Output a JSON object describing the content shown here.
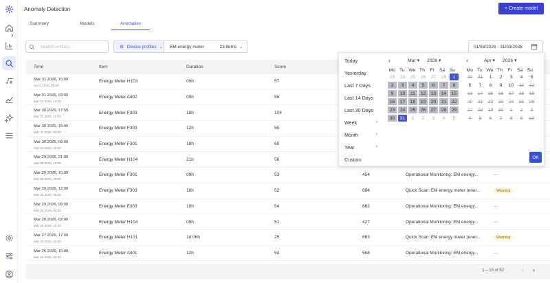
{
  "header": {
    "title": "Anomaly Detection",
    "create_button": "+ Create model"
  },
  "tabs": [
    {
      "label": "Summary"
    },
    {
      "label": "Models"
    },
    {
      "label": "Anomalies"
    }
  ],
  "filters": {
    "search_placeholder": "Search entities ...",
    "profile_button": "Device profiles",
    "profile_value": "EM energy meter",
    "profile_count": "23 items",
    "date_range": "01/03/2026 - 31/03/2026"
  },
  "table": {
    "columns": {
      "time": "Time",
      "item": "Item",
      "duration": "Duration",
      "score": "Score"
    },
    "rows": [
      {
        "time": "Mar 31 2026, 15:00",
        "sub": "Apr 1 2026, 00:00",
        "item": "Energy Meter H103",
        "duration": "09h",
        "score": "57",
        "count": "",
        "source": "",
        "extra": "",
        "badge": ""
      },
      {
        "time": "Mar 31 2026, 03:00",
        "sub": "Mar 31 2026, 12:00",
        "item": "Energy Meter A402",
        "duration": "09h",
        "score": "56",
        "count": "",
        "source": "",
        "extra": "",
        "badge": ""
      },
      {
        "time": "Mar 30 2026, 17:59",
        "sub": "Mar 31 2026, 11:59",
        "item": "Energy Meter F303",
        "duration": "18h",
        "score": "104",
        "count": "",
        "source": "",
        "extra": "",
        "badge": ""
      },
      {
        "time": "Mar 30 2026, 15:00",
        "sub": "Mar 31 2026, 03:00",
        "item": "Energy Meter F303",
        "duration": "12h",
        "score": "55",
        "count": "",
        "source": "",
        "extra": "",
        "badge": ""
      },
      {
        "time": "Mar 30 2026, 09:00",
        "sub": "Mar 31 2026, 00:00",
        "item": "Energy Meter F301",
        "duration": "18h",
        "score": "60",
        "count": "",
        "source": "",
        "extra": "",
        "badge": ""
      },
      {
        "time": "Mar 29 2026, 21:00",
        "sub": "Mar 30 2026, 18:00",
        "item": "Energy Meter H104",
        "duration": "21h",
        "score": "56",
        "count": "",
        "source": "",
        "extra": "",
        "badge": ""
      },
      {
        "time": "Mar 29 2026, 15:00",
        "sub": "Mar 30 2026, 00:00",
        "item": "Energy Meter F301",
        "duration": "09h",
        "score": "53",
        "count": "454",
        "source": "Operational Monitoring: EM energy...",
        "extra": "—",
        "badge": ""
      },
      {
        "time": "Mar 29 2026, 12:00",
        "sub": "Mar 30 2026, 06:00",
        "item": "Energy Meter F303",
        "duration": "18h",
        "score": "52",
        "count": "684",
        "source": "Quick Scan: EM energy meter (ener...",
        "extra": "",
        "badge": "Warning"
      },
      {
        "time": "Mar 29 2026, 09:00",
        "sub": "Mar 30 2026, 03:00",
        "item": "Energy Meter F303",
        "duration": "18h",
        "score": "54",
        "count": "862",
        "source": "Operational Monitoring: EM energy...",
        "extra": "—",
        "badge": ""
      },
      {
        "time": "Mar 28 2026, 02:00",
        "sub": "Mar 28 2026, 11:00",
        "item": "Energy Meter H104",
        "duration": "09h",
        "score": "51",
        "count": "427",
        "source": "Operational Monitoring: EM energy...",
        "extra": "—",
        "badge": ""
      },
      {
        "time": "Mar 27 2026, 17:00",
        "sub": "Mar 29 2026, 00:00",
        "item": "Energy Meter H101",
        "duration": "1d 06h",
        "score": "25",
        "count": "663",
        "source": "Quick Scan: EM energy meter (ener...",
        "extra": "",
        "badge": "Warning"
      },
      {
        "time": "Mar 26 2026, 15:00",
        "sub": "Mar 26 2026, 03:00",
        "item": "Energy Meter A401",
        "duration": "12h",
        "score": "53",
        "count": "558",
        "source": "Operational Monitoring: EM energy...",
        "extra": "—",
        "badge": ""
      }
    ],
    "pagination": "1 – 15 of 52"
  },
  "datepicker": {
    "presets": [
      {
        "label": "Today",
        "arrow": ""
      },
      {
        "label": "Yesterday",
        "arrow": ""
      },
      {
        "label": "Last 7 Days",
        "arrow": ""
      },
      {
        "label": "Last 14 Days",
        "arrow": ""
      },
      {
        "label": "Last 30 Days",
        "arrow": ""
      },
      {
        "label": "Week",
        "arrow": "›"
      },
      {
        "label": "Month",
        "arrow": "›"
      },
      {
        "label": "Year",
        "arrow": "›"
      },
      {
        "label": "Custom",
        "arrow": ""
      }
    ],
    "weekdays": [
      "Mo",
      "Tu",
      "We",
      "Th",
      "Fr",
      "Sa",
      "Su"
    ],
    "left": {
      "month": "Mar",
      "year": "2026",
      "days": [
        {
          "d": "23",
          "s": "muted"
        },
        {
          "d": "24",
          "s": "muted"
        },
        {
          "d": "25",
          "s": "muted"
        },
        {
          "d": "26",
          "s": "muted"
        },
        {
          "d": "27",
          "s": "muted"
        },
        {
          "d": "28",
          "s": "muted"
        },
        {
          "d": "1",
          "s": "sel"
        },
        {
          "d": "2",
          "s": "range"
        },
        {
          "d": "3",
          "s": "range"
        },
        {
          "d": "4",
          "s": "range"
        },
        {
          "d": "5",
          "s": "range"
        },
        {
          "d": "6",
          "s": "range"
        },
        {
          "d": "7",
          "s": "range"
        },
        {
          "d": "8",
          "s": "range"
        },
        {
          "d": "9",
          "s": "range"
        },
        {
          "d": "10",
          "s": "range"
        },
        {
          "d": "11",
          "s": "range"
        },
        {
          "d": "12",
          "s": "range"
        },
        {
          "d": "13",
          "s": "range"
        },
        {
          "d": "14",
          "s": "range"
        },
        {
          "d": "15",
          "s": "range"
        },
        {
          "d": "16",
          "s": "range"
        },
        {
          "d": "17",
          "s": "range"
        },
        {
          "d": "18",
          "s": "range"
        },
        {
          "d": "19",
          "s": "range"
        },
        {
          "d": "20",
          "s": "range"
        },
        {
          "d": "21",
          "s": "range"
        },
        {
          "d": "22",
          "s": "range"
        },
        {
          "d": "23",
          "s": "range"
        },
        {
          "d": "24",
          "s": "range"
        },
        {
          "d": "25",
          "s": "range"
        },
        {
          "d": "26",
          "s": "range"
        },
        {
          "d": "27",
          "s": "range"
        },
        {
          "d": "28",
          "s": "range"
        },
        {
          "d": "29",
          "s": "range"
        },
        {
          "d": "30",
          "s": "range"
        },
        {
          "d": "31",
          "s": "sel"
        },
        {
          "d": "1",
          "s": "muted"
        },
        {
          "d": "2",
          "s": "muted"
        },
        {
          "d": "3",
          "s": "muted"
        },
        {
          "d": "4",
          "s": "muted"
        },
        {
          "d": "5",
          "s": "muted"
        }
      ]
    },
    "right": {
      "month": "Apr",
      "year": "2026",
      "days": [
        {
          "d": "30",
          "s": "strike"
        },
        {
          "d": "31",
          "s": "strike"
        },
        {
          "d": "1",
          "s": "normal"
        },
        {
          "d": "2",
          "s": "normal"
        },
        {
          "d": "3",
          "s": "normal"
        },
        {
          "d": "4",
          "s": "normal"
        },
        {
          "d": "5",
          "s": "normal"
        },
        {
          "d": "6",
          "s": "normal"
        },
        {
          "d": "7",
          "s": "normal"
        },
        {
          "d": "8",
          "s": "normal"
        },
        {
          "d": "9",
          "s": "normal"
        },
        {
          "d": "10",
          "s": "normal"
        },
        {
          "d": "11",
          "s": "strike"
        },
        {
          "d": "12",
          "s": "strike"
        },
        {
          "d": "13",
          "s": "strike"
        },
        {
          "d": "14",
          "s": "strike"
        },
        {
          "d": "15",
          "s": "strike"
        },
        {
          "d": "16",
          "s": "strike"
        },
        {
          "d": "17",
          "s": "strike"
        },
        {
          "d": "18",
          "s": "strike"
        },
        {
          "d": "19",
          "s": "strike"
        },
        {
          "d": "20",
          "s": "strike"
        },
        {
          "d": "21",
          "s": "strike"
        },
        {
          "d": "22",
          "s": "strike"
        },
        {
          "d": "23",
          "s": "strike"
        },
        {
          "d": "24",
          "s": "strike"
        },
        {
          "d": "25",
          "s": "strike"
        },
        {
          "d": "26",
          "s": "strike"
        },
        {
          "d": "27",
          "s": "strike"
        },
        {
          "d": "28",
          "s": "strike"
        },
        {
          "d": "29",
          "s": "strike"
        },
        {
          "d": "30",
          "s": "strike"
        },
        {
          "d": "1",
          "s": "strike"
        },
        {
          "d": "2",
          "s": "strike"
        },
        {
          "d": "3",
          "s": "strike"
        },
        {
          "d": "4",
          "s": "strike"
        },
        {
          "d": "5",
          "s": "strike"
        },
        {
          "d": "6",
          "s": "strike"
        },
        {
          "d": "7",
          "s": "strike"
        },
        {
          "d": "8",
          "s": "strike"
        },
        {
          "d": "9",
          "s": "strike"
        },
        {
          "d": "10",
          "s": "strike"
        }
      ]
    },
    "ok_label": "OK"
  },
  "colors": {
    "accent": "#3b3fcf",
    "range_fill": "#b8bac4",
    "warning_bg": "#fff6d9"
  },
  "icons": [
    "logo-icon",
    "home-icon",
    "chart-icon",
    "search-icon",
    "function-icon",
    "trend-icon",
    "sparkle-icon",
    "list-icon",
    "settings-icon",
    "sliders-icon",
    "user-icon",
    "calendar-icon"
  ]
}
